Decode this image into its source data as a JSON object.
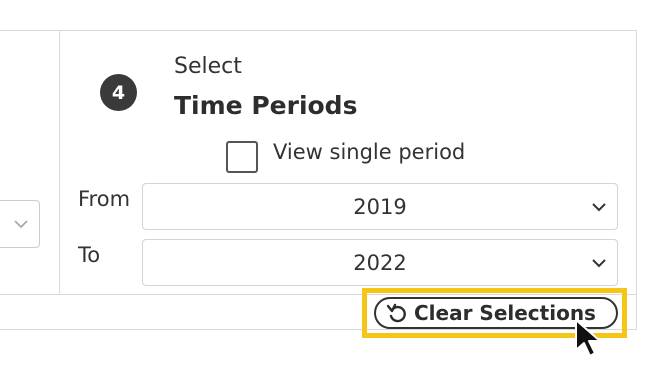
{
  "step": {
    "number": "4",
    "prefix": "Select",
    "title": "Time Periods"
  },
  "single_period": {
    "label": "View single period",
    "checked": false
  },
  "from": {
    "label": "From",
    "value": "2019"
  },
  "to": {
    "label": "To",
    "value": "2022"
  },
  "clear_button": {
    "label": "Clear Selections",
    "icon": "reset-icon"
  },
  "colors": {
    "highlight": "#f5c518",
    "badge": "#3a3a3a"
  }
}
